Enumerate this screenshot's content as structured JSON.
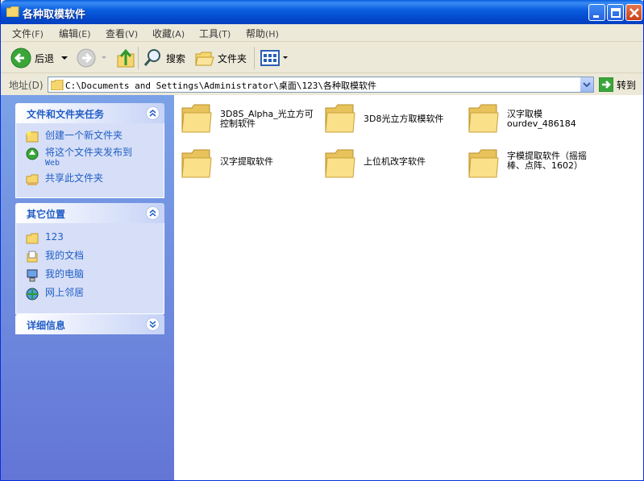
{
  "window": {
    "title": "各种取模软件"
  },
  "menu": [
    {
      "label": "文件",
      "key": "(F)"
    },
    {
      "label": "编辑",
      "key": "(E)"
    },
    {
      "label": "查看",
      "key": "(V)"
    },
    {
      "label": "收藏",
      "key": "(A)"
    },
    {
      "label": "工具",
      "key": "(T)"
    },
    {
      "label": "帮助",
      "key": "(H)"
    }
  ],
  "toolbar": {
    "back_label": "后退",
    "search_label": "搜索",
    "folders_label": "文件夹"
  },
  "address": {
    "label": "地址(D)",
    "path": "C:\\Documents and Settings\\Administrator\\桌面\\123\\各种取模软件",
    "go_label": "转到"
  },
  "left_pane": {
    "tasks": {
      "title": "文件和文件夹任务",
      "items": [
        {
          "label": "创建一个新文件夹",
          "icon": "new-folder-icon"
        },
        {
          "label": "将这个文件夹发布到",
          "sub": "Web",
          "icon": "publish-web-icon"
        },
        {
          "label": "共享此文件夹",
          "icon": "share-folder-icon"
        }
      ]
    },
    "other_places": {
      "title": "其它位置",
      "items": [
        {
          "label": "123",
          "icon": "folder-icon"
        },
        {
          "label": "我的文档",
          "icon": "my-documents-icon"
        },
        {
          "label": "我的电脑",
          "icon": "my-computer-icon"
        },
        {
          "label": "网上邻居",
          "icon": "network-icon"
        }
      ]
    },
    "details": {
      "title": "详细信息"
    }
  },
  "files": [
    {
      "name": "3D8S_Alpha_光立方可控制软件"
    },
    {
      "name": "3D8光立方取模软件"
    },
    {
      "name": "汉字取模 ourdev_486184"
    },
    {
      "name": "汉字提取软件"
    },
    {
      "name": "上位机改字软件"
    },
    {
      "name": "字模提取软件（摇摇棒、点阵、1602）"
    }
  ],
  "colors": {
    "titlebar": "#0a5ddf",
    "link": "#215dc6",
    "leftpane": "#7ba2e7"
  }
}
